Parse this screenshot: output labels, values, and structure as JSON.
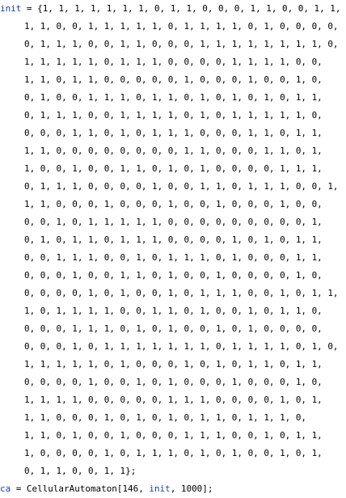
{
  "code": {
    "init_name": "init",
    "init_assign": " = {",
    "init_lines": [
      "1, 1, 1, 1, 1, 1, 1, 0, 1, 1, 0, 0, 0, 1, 1, 0, 0, 1, 1,",
      "1, 1, 0, 0, 1, 1, 1, 1, 1, 0, 1, 1, 1, 1, 0, 1, 0, 0, 0, 0,",
      "0, 1, 1, 1, 0, 0, 1, 1, 0, 0, 0, 1, 1, 1, 1, 1, 1, 1, 1, 0,",
      "1, 1, 1, 1, 1, 0, 1, 1, 1, 0, 0, 0, 0, 1, 1, 1, 1, 0, 0,",
      "1, 1, 0, 1, 1, 0, 0, 0, 0, 0, 1, 0, 0, 0, 1, 0, 0, 1, 0,",
      "0, 1, 0, 0, 1, 1, 1, 0, 1, 1, 0, 1, 0, 1, 0, 1, 0, 1, 1,",
      "0, 1, 1, 1, 0, 0, 1, 1, 1, 1, 0, 1, 0, 1, 1, 1, 1, 1, 0,",
      "0, 0, 0, 1, 1, 0, 1, 0, 1, 1, 1, 0, 0, 0, 1, 1, 0, 1, 1,",
      "1, 1, 0, 0, 0, 0, 0, 0, 0, 0, 1, 1, 0, 0, 0, 1, 1, 0, 1,",
      "1, 0, 0, 1, 0, 0, 1, 1, 0, 1, 0, 1, 0, 0, 0, 0, 1, 1, 1,",
      "0, 1, 1, 1, 0, 0, 0, 0, 1, 0, 0, 1, 1, 0, 1, 1, 1, 0, 0, 1,",
      "1, 1, 0, 0, 0, 1, 0, 0, 0, 1, 0, 0, 1, 0, 0, 0, 1, 0, 0,",
      "0, 0, 1, 0, 1, 1, 1, 1, 1, 0, 0, 0, 0, 0, 0, 0, 0, 0, 1,",
      "0, 1, 0, 1, 1, 0, 1, 1, 1, 0, 0, 0, 0, 1, 0, 1, 0, 1, 1,",
      "0, 0, 1, 1, 1, 0, 0, 1, 0, 1, 1, 1, 0, 1, 0, 0, 0, 1, 1,",
      "0, 0, 0, 1, 0, 0, 1, 1, 0, 1, 0, 0, 1, 0, 0, 0, 0, 1, 0,",
      "0, 0, 0, 0, 1, 0, 1, 0, 0, 1, 0, 1, 1, 1, 0, 0, 1, 0, 1, 1,",
      "1, 0, 1, 1, 1, 1, 0, 0, 1, 1, 0, 1, 0, 0, 1, 0, 1, 1, 0,",
      "0, 0, 0, 1, 1, 1, 0, 1, 0, 1, 0, 0, 1, 0, 1, 0, 0, 0, 0,",
      "0, 0, 0, 1, 0, 1, 1, 1, 1, 1, 1, 1, 0, 1, 1, 1, 1, 0, 1, 0,",
      "1, 1, 1, 1, 1, 0, 1, 0, 0, 0, 1, 0, 1, 0, 1, 1, 0, 1, 1,",
      "0, 0, 0, 0, 1, 0, 0, 1, 0, 1, 0, 0, 0, 1, 0, 0, 0, 1, 0,",
      "1, 1, 1, 1, 0, 0, 0, 0, 0, 1, 1, 1, 0, 0, 0, 0, 1, 0, 1,",
      "1, 1, 0, 0, 0, 1, 0, 1, 0, 1, 0, 1, 1, 0, 1, 1, 1, 0,",
      "1, 1, 0, 1, 0, 0, 1, 0, 0, 0, 1, 1, 1, 0, 0, 1, 0, 1, 1,",
      "1, 0, 0, 0, 0, 1, 0, 1, 1, 1, 0, 1, 0, 1, 0, 0, 1, 0, 1,",
      "0, 1, 1, 0, 0, 1, 1};"
    ],
    "ca_name": "ca",
    "ca_assign": " = CellularAutomaton[146, ",
    "ca_arg": "init",
    "ca_rest": ", 1000];"
  }
}
